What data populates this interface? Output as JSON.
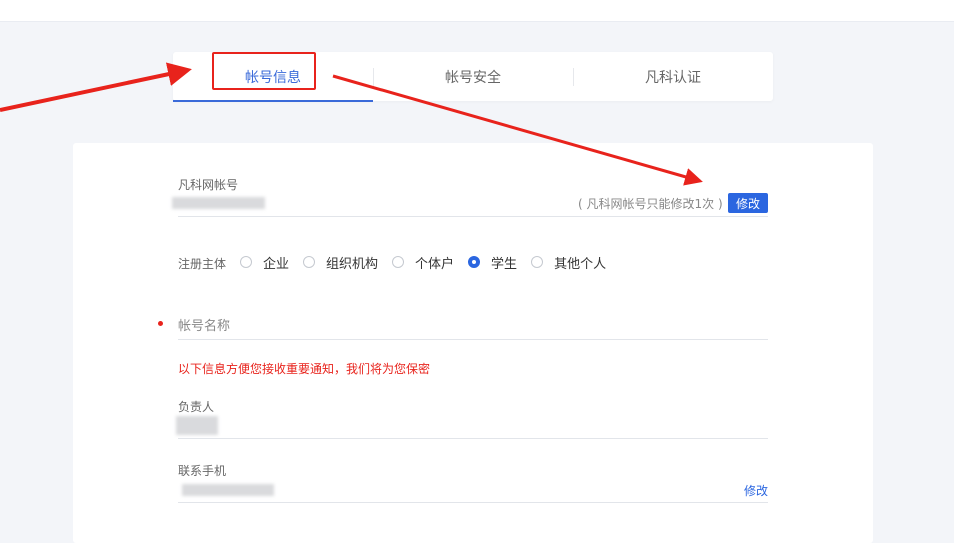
{
  "tabs": [
    {
      "label": "帐号信息",
      "active": true
    },
    {
      "label": "帐号安全",
      "active": false
    },
    {
      "label": "凡科认证",
      "active": false
    }
  ],
  "account": {
    "label": "凡科网帐号",
    "hint": "( 凡科网帐号只能修改1次 )",
    "edit_label": "修改"
  },
  "registration": {
    "label": "注册主体",
    "options": [
      {
        "label": "企业",
        "selected": false
      },
      {
        "label": "组织机构",
        "selected": false
      },
      {
        "label": "个体户",
        "selected": false
      },
      {
        "label": "学生",
        "selected": true
      },
      {
        "label": "其他个人",
        "selected": false
      }
    ]
  },
  "account_name": {
    "placeholder": "帐号名称",
    "required": true
  },
  "notice": "以下信息方便您接收重要通知，我们将为您保密",
  "person_in_charge": {
    "label": "负责人"
  },
  "phone": {
    "label": "联系手机",
    "edit_label": "修改"
  },
  "colors": {
    "accent": "#2b66e0",
    "annotation_red": "#e8231c"
  }
}
